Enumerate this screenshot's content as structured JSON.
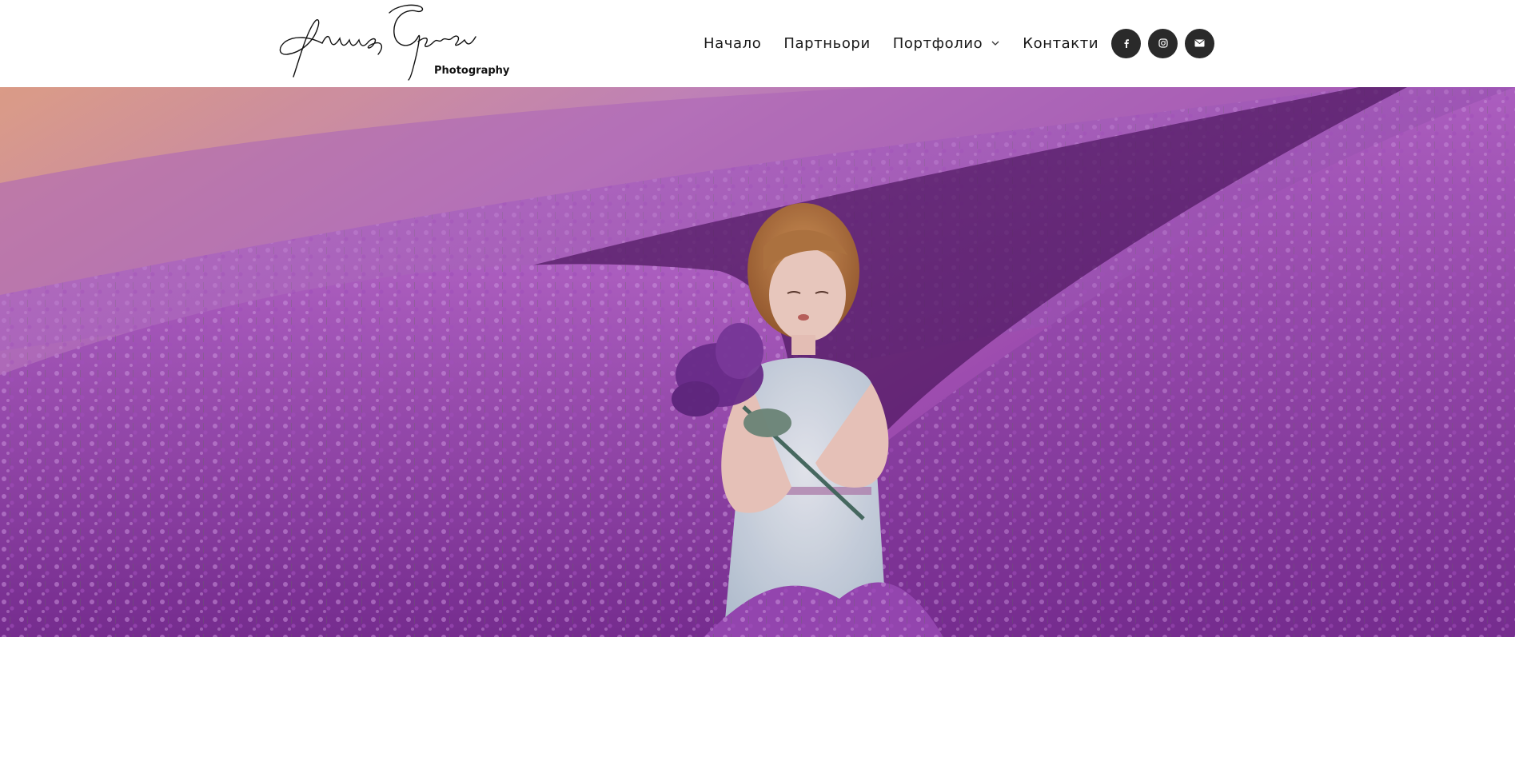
{
  "brand": {
    "signature": "Atanas Gerov",
    "tagline": "Photography"
  },
  "nav": {
    "items": [
      {
        "label": "Начало"
      },
      {
        "label": "Партньори"
      },
      {
        "label": "Портфолио",
        "has_dropdown": true
      },
      {
        "label": "Контакти"
      }
    ]
  },
  "socials": [
    {
      "icon": "facebook-icon"
    },
    {
      "icon": "instagram-icon"
    },
    {
      "icon": "envelope-icon"
    }
  ],
  "colors": {
    "social_bg": "#2a2a2a",
    "lavender_dark": "#5e1f7a",
    "lavender_light": "#c07ad8",
    "haze": "#e3a98f"
  }
}
